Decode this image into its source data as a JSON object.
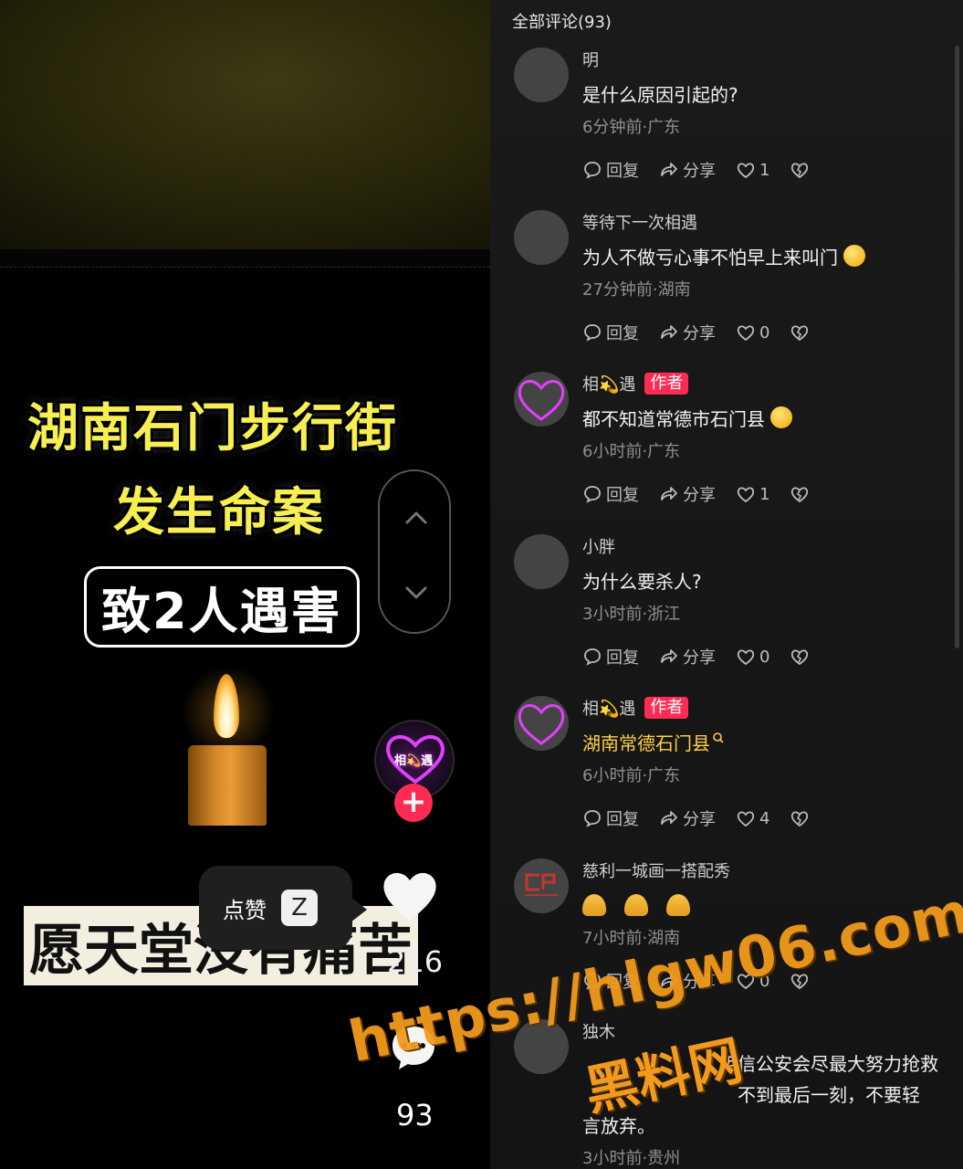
{
  "video": {
    "title_line1": "湖南石门步行街",
    "title_line2": "发生命案",
    "title_line3": "致2人遇害",
    "caption": "愿天堂没有痛苦",
    "creator_avatar_text": "相💫遇",
    "like_count": "216",
    "comment_count": "93",
    "tooltip": {
      "label": "点赞",
      "key": "Z"
    }
  },
  "comments_panel": {
    "header": "全部评论(93)",
    "actions": {
      "reply": "回复",
      "share": "分享"
    },
    "comments": [
      {
        "name": "明",
        "text": "是什么原因引起的?",
        "meta": "6分钟前·广东",
        "likes": "1",
        "author": false
      },
      {
        "name": "等待下一次相遇",
        "text": "为人不做亏心事不怕早上来叫门",
        "meta": "27分钟前·湖南",
        "likes": "0",
        "author": false
      },
      {
        "name": "相💫遇",
        "badge": "作者",
        "text": "都不知道常德市石门县",
        "meta": "6小时前·广东",
        "likes": "1",
        "author": true
      },
      {
        "name": "小胖",
        "text": "为什么要杀人?",
        "meta": "3小时前·浙江",
        "likes": "0",
        "author": false
      },
      {
        "name": "相💫遇",
        "badge": "作者",
        "text": "湖南常德石门县",
        "meta": "6小时前·广东",
        "likes": "4",
        "author": true
      },
      {
        "name": "慈利一城画一搭配秀",
        "text": "",
        "meta": "7小时前·湖南",
        "likes": "0",
        "author": false
      },
      {
        "name": "独木",
        "text_line1": "相信公安会尽最大努力抢救",
        "text_line2": "不到最后一刻，不要轻",
        "text_line3": "言放弃。",
        "meta": "3小时前·贵州"
      }
    ]
  },
  "watermark": {
    "url": "https://hlgw06.com",
    "name": "黑料网"
  },
  "colors": {
    "accent": "#fe2c55",
    "title_yellow": "#f7ef52",
    "link_yellow": "#ffcf4a",
    "watermark": "#f29a1c"
  }
}
